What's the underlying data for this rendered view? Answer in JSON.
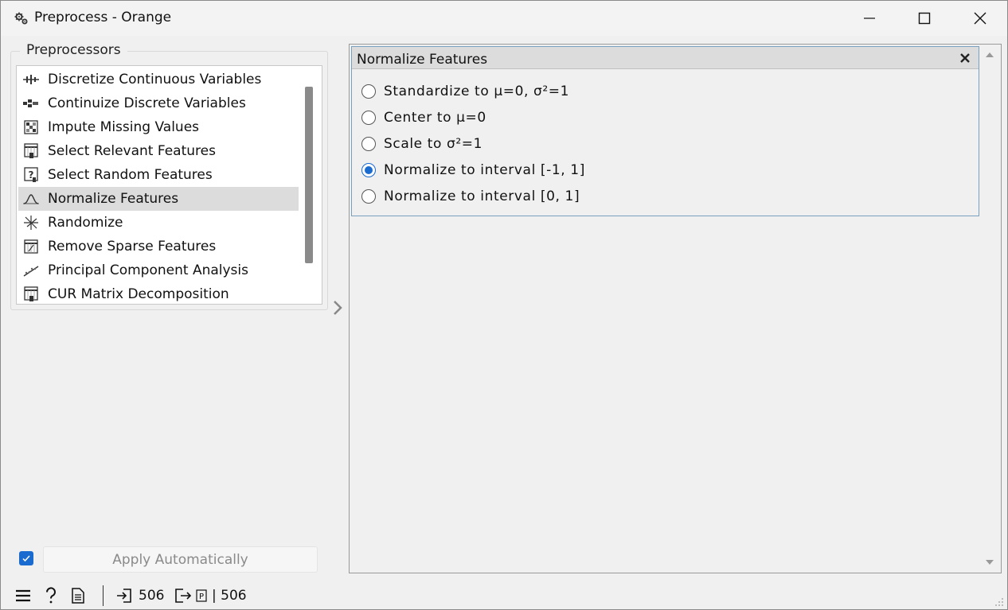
{
  "window": {
    "title": "Preprocess - Orange",
    "icon": "gears-icon",
    "controls": [
      "minimize-icon",
      "maximize-icon",
      "close-icon"
    ]
  },
  "preprocessors": {
    "group_title": "Preprocessors",
    "items": [
      {
        "label": "Discretize Continuous Variables",
        "icon": "discretize-icon"
      },
      {
        "label": "Continuize Discrete Variables",
        "icon": "continuize-icon"
      },
      {
        "label": "Impute Missing Values",
        "icon": "impute-icon"
      },
      {
        "label": "Select Relevant Features",
        "icon": "select-relevant-icon"
      },
      {
        "label": "Select Random Features",
        "icon": "select-random-icon"
      },
      {
        "label": "Normalize Features",
        "icon": "normalize-icon",
        "selected": true
      },
      {
        "label": "Randomize",
        "icon": "randomize-icon"
      },
      {
        "label": "Remove Sparse Features",
        "icon": "remove-sparse-icon"
      },
      {
        "label": "Principal Component Analysis",
        "icon": "pca-icon"
      },
      {
        "label": "CUR Matrix Decomposition",
        "icon": "cur-icon"
      }
    ]
  },
  "panel": {
    "title": "Normalize Features",
    "options": [
      {
        "label": "Standardize to μ=0, σ²=1",
        "checked": false
      },
      {
        "label": "Center to μ=0",
        "checked": false
      },
      {
        "label": "Scale to σ²=1",
        "checked": false
      },
      {
        "label": "Normalize to interval [-1, 1]",
        "checked": true
      },
      {
        "label": "Normalize to interval [0, 1]",
        "checked": false
      }
    ]
  },
  "footer": {
    "apply_automatically_checked": true,
    "apply_label": "Apply Automatically"
  },
  "statusbar": {
    "input_count": "506",
    "output_count": "| 506"
  },
  "colors": {
    "accent": "#1a6bd0",
    "selected_row": "#dcdcdc",
    "background": "#f0f0f0"
  }
}
